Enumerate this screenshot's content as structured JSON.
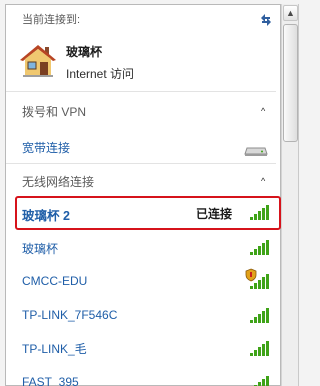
{
  "header": {
    "title": "当前连接到:",
    "refresh_icon": "refresh-icon"
  },
  "current_connection": {
    "name": "玻璃杯",
    "status": "Internet 访问",
    "icon": "house-icon"
  },
  "sections": {
    "dialup": {
      "label": "拨号和 VPN",
      "collapse_glyph": "^",
      "items": [
        {
          "label": "宽带连接",
          "icon": "modem-icon"
        }
      ]
    },
    "wireless": {
      "label": "无线网络连接",
      "collapse_glyph": "^",
      "networks": [
        {
          "name": "玻璃杯 2",
          "status": "已连接",
          "signal": 5,
          "selected": true,
          "secured": false
        },
        {
          "name": "玻璃杯",
          "status": "",
          "signal": 5,
          "selected": false,
          "secured": false
        },
        {
          "name": "CMCC-EDU",
          "status": "",
          "signal": 5,
          "selected": false,
          "secured": true
        },
        {
          "name": "TP-LINK_7F546C",
          "status": "",
          "signal": 5,
          "selected": false,
          "secured": false
        },
        {
          "name": "TP-LINK_毛",
          "status": "",
          "signal": 5,
          "selected": false,
          "secured": false
        },
        {
          "name": "FAST_395",
          "status": "",
          "signal": 5,
          "selected": false,
          "secured": false
        }
      ]
    }
  },
  "colors": {
    "link": "#1f5ea8",
    "highlight": "#d6131b",
    "signal": "#3fa318"
  }
}
